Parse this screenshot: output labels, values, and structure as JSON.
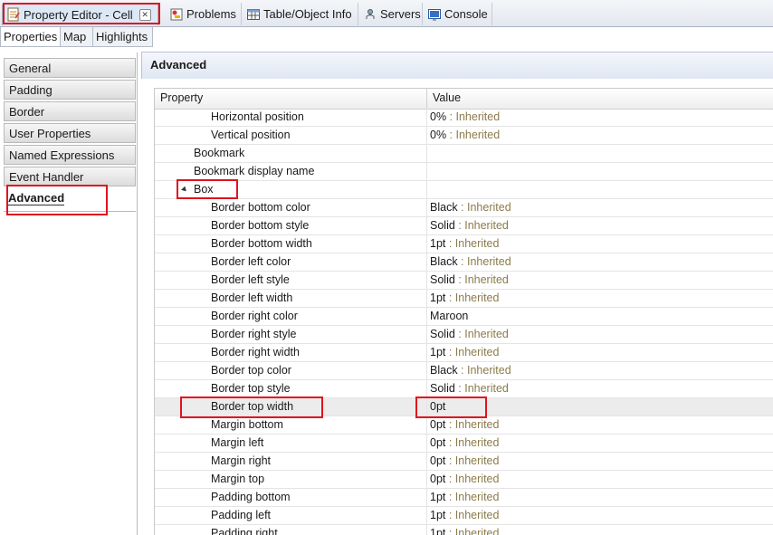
{
  "view_tabs": [
    {
      "label": "Property Editor - Cell",
      "icon": "property-editor-icon",
      "active": true,
      "closable": true
    },
    {
      "label": "Problems",
      "icon": "problems-icon"
    },
    {
      "label": "Table/Object Info",
      "icon": "table-icon"
    },
    {
      "label": "Servers",
      "icon": "servers-icon"
    },
    {
      "label": "Console",
      "icon": "console-icon"
    }
  ],
  "sub_tabs": [
    "Properties",
    "Map",
    "Highlights"
  ],
  "categories": [
    "General",
    "Padding",
    "Border",
    "User Properties",
    "Named Expressions",
    "Event Handler",
    "Advanced"
  ],
  "selected_category": "Advanced",
  "section_title": "Advanced",
  "table": {
    "columns": [
      "Property",
      "Value"
    ],
    "rows": [
      {
        "property": "Horizontal position",
        "value": "0%",
        "inherited": " : Inherited"
      },
      {
        "property": "Vertical position",
        "value": "0%",
        "inherited": " : Inherited"
      },
      {
        "property": "Bookmark",
        "value": "",
        "inherited": ""
      },
      {
        "property": "Bookmark display name",
        "value": "",
        "inherited": ""
      },
      {
        "property": "Box",
        "value": "",
        "inherited": "",
        "expanded": true
      },
      {
        "property": "Border bottom color",
        "value": "Black",
        "inherited": " : Inherited"
      },
      {
        "property": "Border bottom style",
        "value": "Solid",
        "inherited": " : Inherited"
      },
      {
        "property": "Border bottom width",
        "value": "1pt",
        "inherited": " : Inherited"
      },
      {
        "property": "Border left color",
        "value": "Black",
        "inherited": " : Inherited"
      },
      {
        "property": "Border left style",
        "value": "Solid",
        "inherited": " : Inherited"
      },
      {
        "property": "Border left width",
        "value": "1pt",
        "inherited": " : Inherited"
      },
      {
        "property": "Border right color",
        "value": "Maroon",
        "inherited": ""
      },
      {
        "property": "Border right style",
        "value": "Solid",
        "inherited": " : Inherited"
      },
      {
        "property": "Border right width",
        "value": "1pt",
        "inherited": " : Inherited"
      },
      {
        "property": "Border top color",
        "value": "Black",
        "inherited": " : Inherited"
      },
      {
        "property": "Border top style",
        "value": "Solid",
        "inherited": " : Inherited"
      },
      {
        "property": "Border top width",
        "value": "0pt",
        "inherited": "",
        "selected": true
      },
      {
        "property": "Margin bottom",
        "value": "0pt",
        "inherited": " : Inherited"
      },
      {
        "property": "Margin left",
        "value": "0pt",
        "inherited": " : Inherited"
      },
      {
        "property": "Margin right",
        "value": "0pt",
        "inherited": " : Inherited"
      },
      {
        "property": "Margin top",
        "value": "0pt",
        "inherited": " : Inherited"
      },
      {
        "property": "Padding bottom",
        "value": "1pt",
        "inherited": " : Inherited"
      },
      {
        "property": "Padding left",
        "value": "1pt",
        "inherited": " : Inherited"
      },
      {
        "property": "Padding right",
        "value": "1pt",
        "inherited": " : Inherited"
      }
    ]
  },
  "colors": {
    "highlight": "#e0141e",
    "inherited_text": "#8b7b4b",
    "selected_row": "#ececec"
  }
}
